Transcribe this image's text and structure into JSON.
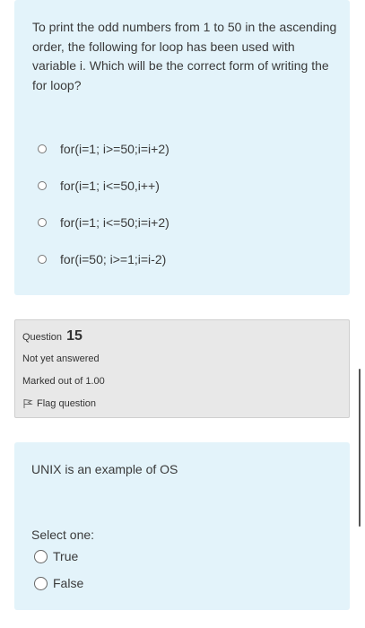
{
  "question14": {
    "text": "To print the odd numbers from 1 to 50 in the ascending order, the following for loop has been used with variable i. Which will be the correct form of writing the for loop?",
    "options": [
      "for(i=1; i>=50;i=i+2)",
      "for(i=1; i<=50,i++)",
      "for(i=1; i<=50;i=i+2)",
      "for(i=50; i>=1;i=i-2)"
    ]
  },
  "question15_info": {
    "label": "Question",
    "number": "15",
    "status": "Not yet answered",
    "marks": "Marked out of 1.00",
    "flag": "Flag question"
  },
  "question15": {
    "text": "UNIX is an example of OS",
    "select_prompt": "Select one:",
    "options": [
      "True",
      "False"
    ]
  }
}
